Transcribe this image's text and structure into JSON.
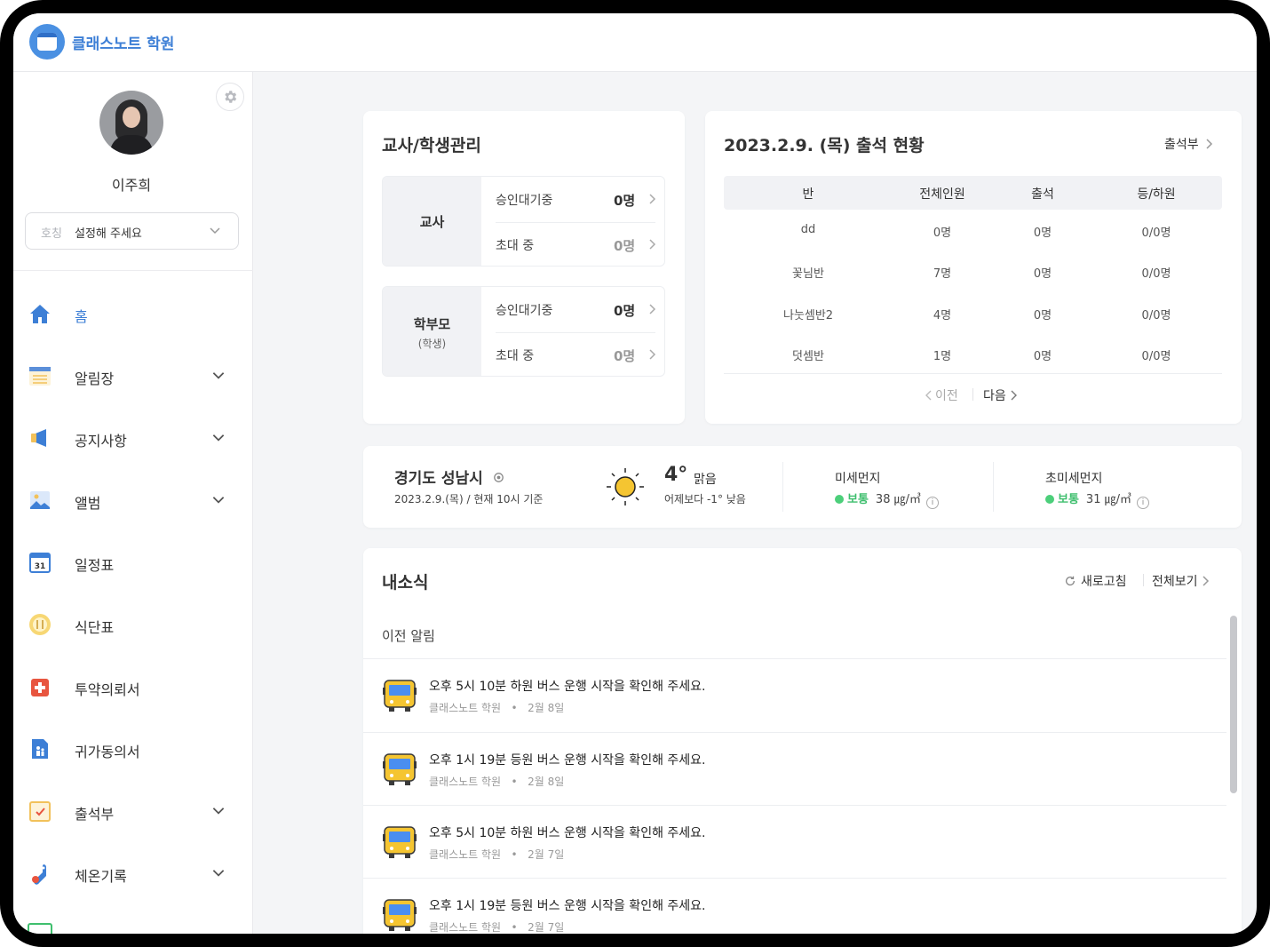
{
  "app": {
    "title": "클래스노트 학원"
  },
  "profile": {
    "name": "이주희",
    "title_label": "호칭",
    "title_placeholder": "설정해 주세요"
  },
  "nav": [
    {
      "label": "홈",
      "icon": "home-icon",
      "active": true,
      "expandable": false
    },
    {
      "label": "알림장",
      "icon": "notebook-icon",
      "expandable": true
    },
    {
      "label": "공지사항",
      "icon": "megaphone-icon",
      "expandable": true
    },
    {
      "label": "앨범",
      "icon": "photo-icon",
      "expandable": true
    },
    {
      "label": "일정표",
      "icon": "calendar-icon",
      "expandable": false,
      "icon_text": "31"
    },
    {
      "label": "식단표",
      "icon": "meal-icon",
      "expandable": false
    },
    {
      "label": "투약의뢰서",
      "icon": "medicine-icon",
      "expandable": false
    },
    {
      "label": "귀가동의서",
      "icon": "consent-icon",
      "expandable": false
    },
    {
      "label": "출석부",
      "icon": "attendance-icon",
      "expandable": true
    },
    {
      "label": "체온기록",
      "icon": "thermometer-icon",
      "expandable": true
    }
  ],
  "management": {
    "title": "교사/학생관리",
    "groups": [
      {
        "head": "교사",
        "sub": "",
        "rows": [
          {
            "label": "승인대기중",
            "value": "0명",
            "muted": false
          },
          {
            "label": "초대 중",
            "value": "0명",
            "muted": true
          }
        ]
      },
      {
        "head": "학부모",
        "sub": "(학생)",
        "rows": [
          {
            "label": "승인대기중",
            "value": "0명",
            "muted": false
          },
          {
            "label": "초대 중",
            "value": "0명",
            "muted": true
          }
        ]
      }
    ]
  },
  "attendance": {
    "title": "2023.2.9. (목) 출석 현황",
    "link": "출석부",
    "columns": [
      "반",
      "전체인원",
      "출석",
      "등/하원"
    ],
    "rows": [
      [
        "dd",
        "0명",
        "0명",
        "0/0명"
      ],
      [
        "꽃님반",
        "7명",
        "0명",
        "0/0명"
      ],
      [
        "나눗셈반2",
        "4명",
        "0명",
        "0/0명"
      ],
      [
        "덧셈반",
        "1명",
        "0명",
        "0/0명"
      ]
    ],
    "prev": "이전",
    "next": "다음"
  },
  "weather": {
    "location": "경기도 성남시",
    "time": "2023.2.9.(목) / 현재 10시 기준",
    "temp": "4°",
    "condition": "맑음",
    "compare": "어제보다 -1° 낮음",
    "dust": {
      "label": "미세먼지",
      "status": "보통",
      "value": "38 ㎍/㎥",
      "status_color": "#3fbf6e"
    },
    "fine_dust": {
      "label": "초미세먼지",
      "status": "보통",
      "value": "31 ㎍/㎥",
      "status_color": "#3fbf6e"
    }
  },
  "news": {
    "title": "내소식",
    "refresh": "새로고침",
    "view_all": "전체보기",
    "section": "이전 알림",
    "items": [
      {
        "message": "오후 5시 10분 하원 버스 운행 시작을 확인해 주세요.",
        "source": "클래스노트 학원",
        "date": "2월 8일"
      },
      {
        "message": "오후 1시 19분 등원 버스 운행 시작을 확인해 주세요.",
        "source": "클래스노트 학원",
        "date": "2월 8일"
      },
      {
        "message": "오후 5시 10분 하원 버스 운행 시작을 확인해 주세요.",
        "source": "클래스노트 학원",
        "date": "2월 7일"
      },
      {
        "message": "오후 1시 19분 등원 버스 운행 시작을 확인해 주세요.",
        "source": "클래스노트 학원",
        "date": "2월 7일"
      }
    ]
  },
  "colors": {
    "accent": "#3d7fd6",
    "background": "#f4f5f7",
    "status_ok": "#3fbf6e"
  }
}
